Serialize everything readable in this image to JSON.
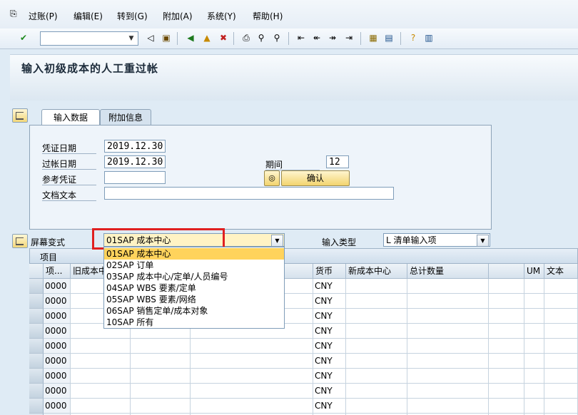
{
  "menu": {
    "items": [
      "过账(P)",
      "编辑(E)",
      "转到(G)",
      "附加(A)",
      "系统(Y)",
      "帮助(H)"
    ]
  },
  "toolbar": {
    "command_value": "",
    "icons": [
      "check-icon",
      "back-triangle-icon",
      "save-icon",
      "back-icon",
      "exit-icon",
      "cancel-icon",
      "print-icon",
      "find-icon",
      "find-next-icon",
      "first-page-icon",
      "prev-page-icon",
      "next-page-icon",
      "last-page-icon",
      "create-session-icon",
      "shortcut-icon",
      "help-icon",
      "layout-icon"
    ]
  },
  "title": "输入初级成本的人工重过帐",
  "tabs": [
    "输入数据",
    "附加信息"
  ],
  "form": {
    "doc_date_label": "凭证日期",
    "doc_date": "2019.12.30",
    "posting_date_label": "过帐日期",
    "posting_date": "2019.12.30",
    "period_label": "期间",
    "period": "12",
    "reference_label": "参考凭证",
    "reference": "",
    "doc_text_label": "文档文本",
    "doc_text": "",
    "confirm_label": "确认"
  },
  "variant": {
    "label": "屏幕变式",
    "value": "01SAP 成本中心",
    "input_type_label": "输入类型",
    "input_type_value": "L 清单输入项"
  },
  "dropdown": {
    "options": [
      "01SAP 成本中心",
      "02SAP 订单",
      "03SAP 成本中心/定单/人员编号",
      "04SAP WBS 要素/定单",
      "05SAP WBS 要素/网络",
      "06SAP 销售定单/成本对象",
      "10SAP 所有"
    ],
    "selected_index": 0
  },
  "table": {
    "title": "项目",
    "columns": [
      "项...",
      "旧成本中心",
      "",
      "",
      "货币",
      "新成本中心",
      "总计数量",
      "",
      "UM",
      "文本"
    ],
    "rows": [
      {
        "item": "0000",
        "currency": "CNY"
      },
      {
        "item": "0000",
        "currency": "CNY"
      },
      {
        "item": "0000",
        "currency": "CNY"
      },
      {
        "item": "0000",
        "currency": "CNY"
      },
      {
        "item": "0000",
        "currency": "CNY"
      },
      {
        "item": "0000",
        "currency": "CNY"
      },
      {
        "item": "0000",
        "currency": "CNY"
      },
      {
        "item": "0000",
        "currency": "CNY"
      },
      {
        "item": "0000",
        "currency": "CNY"
      },
      {
        "item": "0000",
        "currency": "CNY"
      }
    ]
  },
  "colors": {
    "background": "#dfebf5",
    "highlight_border": "#e02020",
    "selected_option": "#ffd35c",
    "button_yellow": "#f2d46e"
  }
}
